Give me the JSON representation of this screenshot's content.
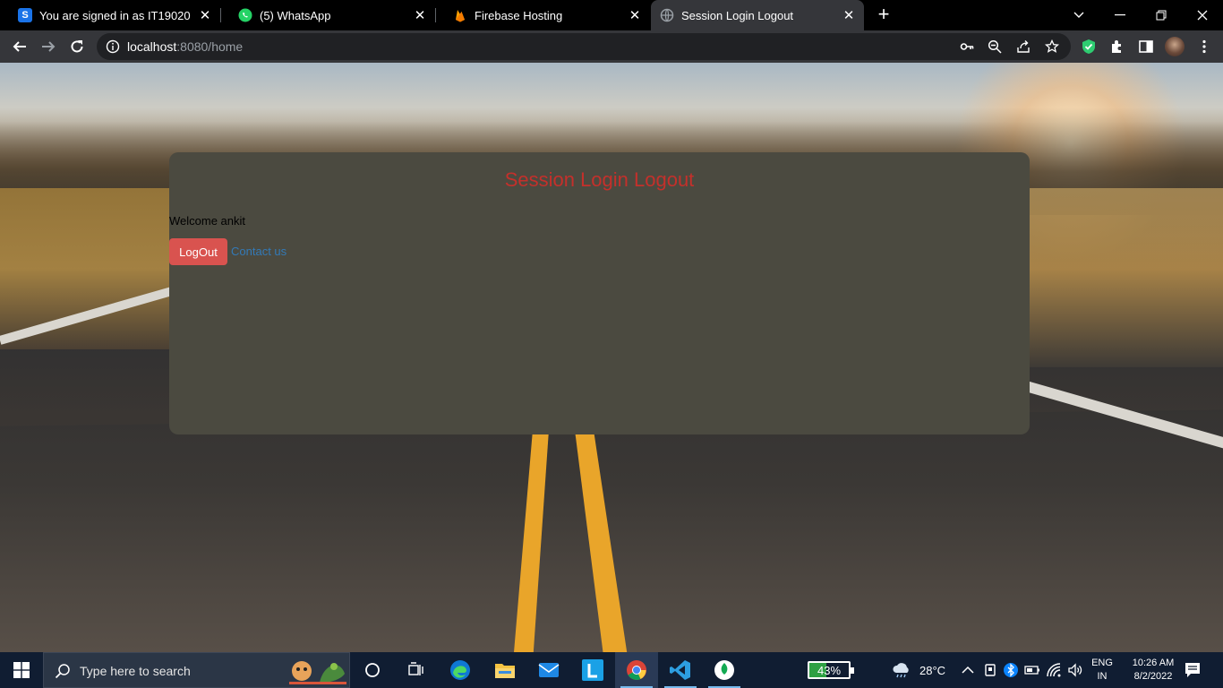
{
  "browser": {
    "tabs": [
      {
        "title": "You are signed in as IT19020",
        "icon": "s-logo-icon",
        "active": false
      },
      {
        "title": "(5) WhatsApp",
        "icon": "whatsapp-icon",
        "active": false
      },
      {
        "title": "Firebase Hosting",
        "icon": "firebase-icon",
        "active": false
      },
      {
        "title": "Session Login Logout",
        "icon": "globe-icon",
        "active": true
      }
    ],
    "url_host": "localhost",
    "url_rest": ":8080/home"
  },
  "page": {
    "title": "Session Login Logout",
    "welcome": "Welcome ankit",
    "logout_label": "LogOut",
    "contact_label": "Contact us",
    "title_color": "#c4302b",
    "button_color": "#d9534f",
    "card_color": "#4b4a40"
  },
  "taskbar": {
    "search_placeholder": "Type here to search",
    "battery": "43%",
    "battery_level": 0.43,
    "temperature": "28°C",
    "lang_top": "ENG",
    "lang_bottom": "IN",
    "time": "10:26 AM",
    "date": "8/2/2022"
  }
}
